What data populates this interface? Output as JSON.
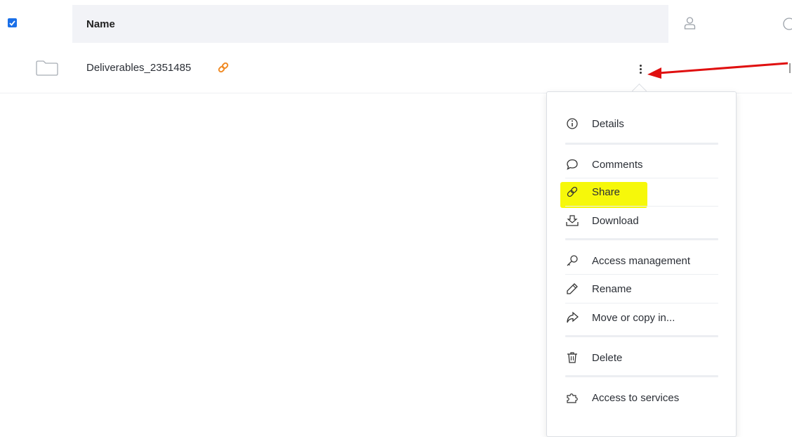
{
  "header": {
    "name_column": "Name"
  },
  "row": {
    "name": "Deliverables_2351485"
  },
  "menu": {
    "items": [
      {
        "label": "Details",
        "icon": "info-icon"
      },
      {
        "label": "Comments",
        "icon": "comment-icon"
      },
      {
        "label": "Share",
        "icon": "link-icon"
      },
      {
        "label": "Download",
        "icon": "download-icon"
      },
      {
        "label": "Access management",
        "icon": "key-icon"
      },
      {
        "label": "Rename",
        "icon": "pencil-icon"
      },
      {
        "label": "Move or copy in...",
        "icon": "move-icon"
      },
      {
        "label": "Delete",
        "icon": "trash-icon"
      },
      {
        "label": "Access to services",
        "icon": "puzzle-icon"
      }
    ]
  },
  "colors": {
    "accent": "#1a6fe8",
    "link_orange": "#f08a24",
    "highlight": "#f6f80a",
    "annotation_arrow": "#e01010"
  }
}
